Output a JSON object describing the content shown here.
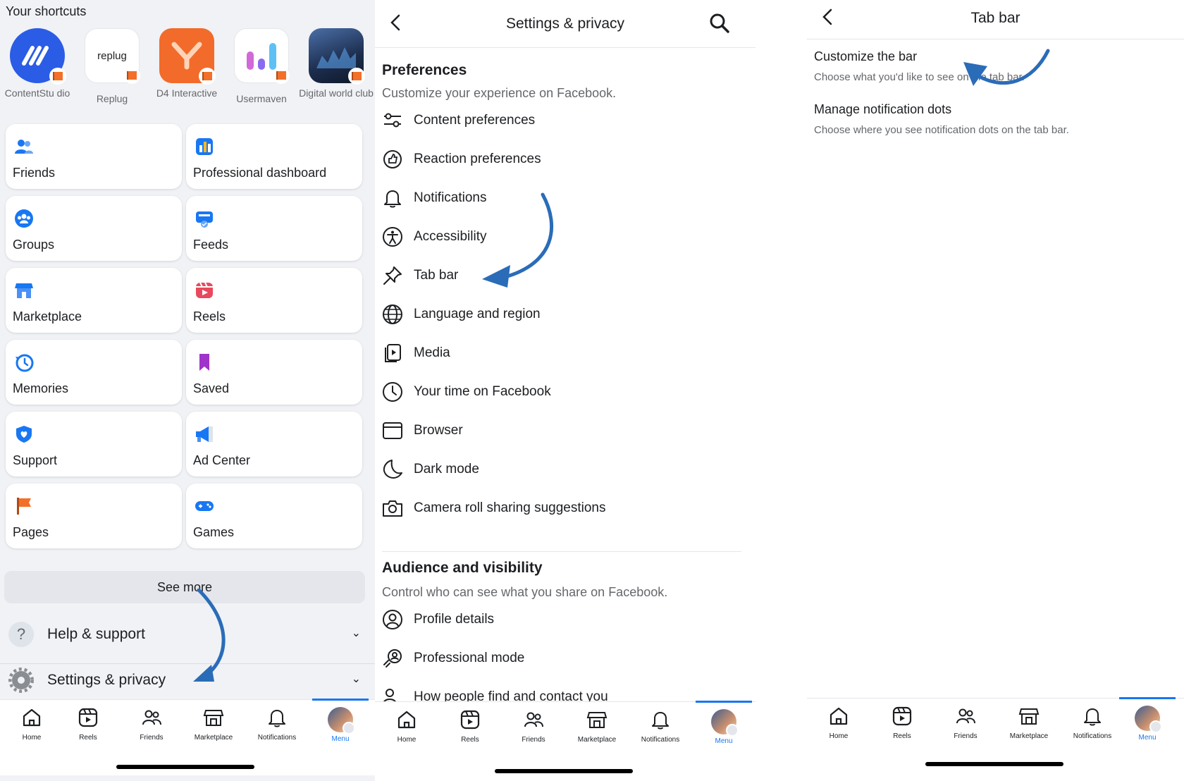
{
  "panel1": {
    "shortcuts_title": "Your shortcuts",
    "shortcuts": [
      {
        "label": "ContentStu dio",
        "icon": "contentstudio-logo-icon",
        "color": "#2b5ce6"
      },
      {
        "label": "Replug",
        "icon": "replug-logo-icon",
        "color": "#ffffff",
        "logo_text": "replug"
      },
      {
        "label": "D4 Interactive",
        "icon": "d4-interactive-logo-icon",
        "color": "#f26b2b"
      },
      {
        "label": "Usermaven",
        "icon": "usermaven-logo-icon",
        "color": "#ffffff"
      },
      {
        "label": "Digital world club",
        "icon": "digital-world-club-logo-icon",
        "color": "#23395d"
      }
    ],
    "tiles": [
      {
        "label": "Friends",
        "icon": "friends-icon"
      },
      {
        "label": "Professional dashboard",
        "icon": "professional-dashboard-icon"
      },
      {
        "label": "Groups",
        "icon": "groups-icon"
      },
      {
        "label": "Feeds",
        "icon": "feeds-icon"
      },
      {
        "label": "Marketplace",
        "icon": "marketplace-icon"
      },
      {
        "label": "Reels",
        "icon": "reels-icon"
      },
      {
        "label": "Memories",
        "icon": "memories-icon"
      },
      {
        "label": "Saved",
        "icon": "saved-icon"
      },
      {
        "label": "Support",
        "icon": "support-icon"
      },
      {
        "label": "Ad Center",
        "icon": "ad-center-icon"
      },
      {
        "label": "Pages",
        "icon": "pages-icon"
      },
      {
        "label": "Games",
        "icon": "games-icon"
      }
    ],
    "see_more": "See more",
    "help_support": "Help & support",
    "settings_privacy": "Settings & privacy"
  },
  "bottom_nav": [
    {
      "label": "Home",
      "icon": "home-icon"
    },
    {
      "label": "Reels",
      "icon": "reels-icon"
    },
    {
      "label": "Friends",
      "icon": "friends-icon"
    },
    {
      "label": "Marketplace",
      "icon": "marketplace-icon"
    },
    {
      "label": "Notifications",
      "icon": "bell-icon"
    },
    {
      "label": "Menu",
      "icon": "avatar",
      "active": true
    }
  ],
  "panel2": {
    "title": "Settings & privacy",
    "preferences": {
      "heading": "Preferences",
      "subtitle": "Customize your experience on Facebook.",
      "items": [
        {
          "label": "Content preferences",
          "icon": "sliders-icon"
        },
        {
          "label": "Reaction preferences",
          "icon": "reaction-icon"
        },
        {
          "label": "Notifications",
          "icon": "bell-icon"
        },
        {
          "label": "Accessibility",
          "icon": "accessibility-icon"
        },
        {
          "label": "Tab bar",
          "icon": "pin-icon"
        },
        {
          "label": "Language and region",
          "icon": "globe-icon"
        },
        {
          "label": "Media",
          "icon": "media-icon"
        },
        {
          "label": "Your time on Facebook",
          "icon": "clock-icon"
        },
        {
          "label": "Browser",
          "icon": "browser-icon"
        },
        {
          "label": "Dark mode",
          "icon": "moon-icon"
        },
        {
          "label": "Camera roll sharing suggestions",
          "icon": "camera-icon"
        }
      ]
    },
    "audience": {
      "heading": "Audience and visibility",
      "subtitle": "Control who can see what you share on Facebook.",
      "items": [
        {
          "label": "Profile details",
          "icon": "profile-icon"
        },
        {
          "label": "Professional mode",
          "icon": "professional-mode-icon"
        },
        {
          "label": "How people find and contact you",
          "icon": "find-people-icon"
        }
      ]
    }
  },
  "panel3": {
    "title": "Tab bar",
    "options": [
      {
        "title": "Customize the bar",
        "subtitle": "Choose what you'd like to see on the tab bar."
      },
      {
        "title": "Manage notification dots",
        "subtitle": "Choose where you see notification dots on the tab bar."
      }
    ]
  },
  "colors": {
    "accent": "#1877f2",
    "annotation_arrow": "#2a6cb8"
  }
}
